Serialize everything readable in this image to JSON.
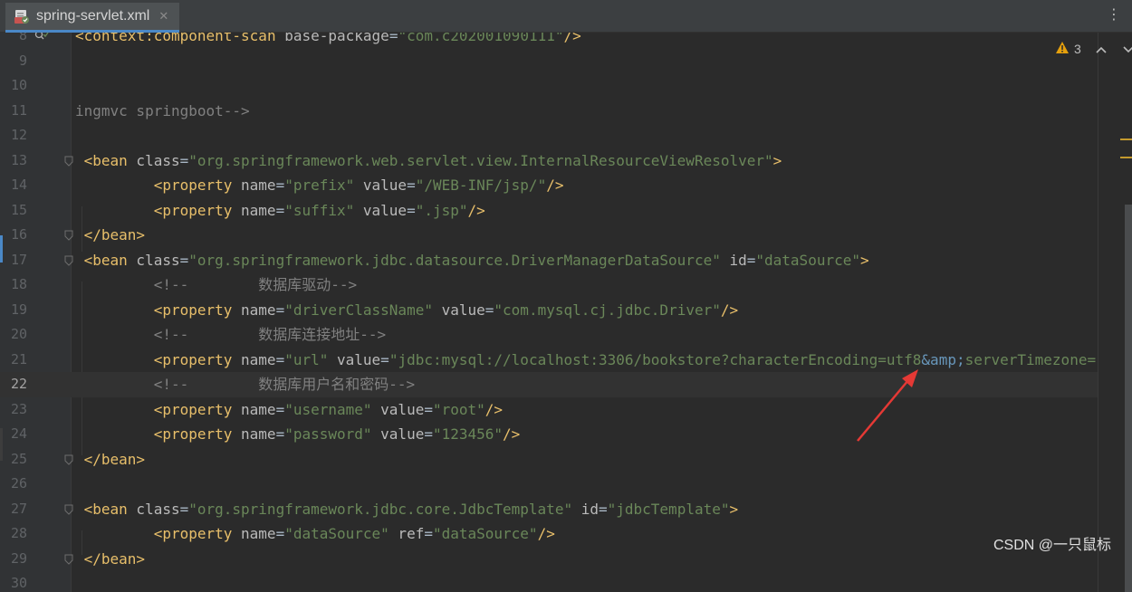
{
  "tab": {
    "title": "spring-servlet.xml",
    "close": "✕"
  },
  "tab_menu": "⋮",
  "inspections": {
    "warning_count": "3",
    "up": "︿",
    "down": "﹀"
  },
  "colors": {
    "accent": "#4a88c7",
    "tag": "#e8bf6a",
    "attribute": "#bababa",
    "value": "#6a8759",
    "comment": "#808080",
    "entity": "#6897bb",
    "warning": "#c49a2e"
  },
  "current_line": 22,
  "lines": [
    {
      "num": "8",
      "tokens": [
        {
          "t": "<",
          "c": "tag"
        },
        {
          "t": "context",
          "c": "tag"
        },
        {
          "t": ":component-scan",
          "c": "tag"
        },
        {
          "t": " base-package",
          "c": "attr"
        },
        {
          "t": "=",
          "c": "plain"
        },
        {
          "t": "\"com.c202001090111\"",
          "c": "val"
        },
        {
          "t": "/>",
          "c": "tag"
        }
      ]
    },
    {
      "num": "9",
      "tokens": []
    },
    {
      "num": "10",
      "tokens": []
    },
    {
      "num": "11",
      "tokens": [
        {
          "t": "ingmvc springboot-->",
          "c": "cmt"
        }
      ]
    },
    {
      "num": "12",
      "tokens": []
    },
    {
      "num": "13",
      "fold": true,
      "tokens": [
        {
          "t": " <bean",
          "c": "tag"
        },
        {
          "t": " class",
          "c": "attr"
        },
        {
          "t": "=",
          "c": "plain"
        },
        {
          "t": "\"org.springframework.web.servlet.view.InternalResourceViewResolver\"",
          "c": "val"
        },
        {
          "t": ">",
          "c": "tag"
        }
      ]
    },
    {
      "num": "14",
      "tokens": [
        {
          "t": "         <property",
          "c": "tag"
        },
        {
          "t": " name",
          "c": "attr"
        },
        {
          "t": "=",
          "c": "plain"
        },
        {
          "t": "\"prefix\"",
          "c": "val"
        },
        {
          "t": " value",
          "c": "attr"
        },
        {
          "t": "=",
          "c": "plain"
        },
        {
          "t": "\"/WEB-INF/jsp/\"",
          "c": "val"
        },
        {
          "t": "/>",
          "c": "tag"
        }
      ]
    },
    {
      "num": "15",
      "tokens": [
        {
          "t": "         <property",
          "c": "tag"
        },
        {
          "t": " name",
          "c": "attr"
        },
        {
          "t": "=",
          "c": "plain"
        },
        {
          "t": "\"suffix\"",
          "c": "val"
        },
        {
          "t": " value",
          "c": "attr"
        },
        {
          "t": "=",
          "c": "plain"
        },
        {
          "t": "\".jsp\"",
          "c": "val"
        },
        {
          "t": "/>",
          "c": "tag"
        }
      ]
    },
    {
      "num": "16",
      "fold": true,
      "tokens": [
        {
          "t": " </bean>",
          "c": "tag"
        }
      ]
    },
    {
      "num": "17",
      "fold": true,
      "tokens": [
        {
          "t": " <bean",
          "c": "tag"
        },
        {
          "t": " class",
          "c": "attr"
        },
        {
          "t": "=",
          "c": "plain"
        },
        {
          "t": "\"org.springframework.jdbc.datasource.DriverManagerDataSource\"",
          "c": "val"
        },
        {
          "t": " id",
          "c": "attr"
        },
        {
          "t": "=",
          "c": "plain"
        },
        {
          "t": "\"dataSource\"",
          "c": "val"
        },
        {
          "t": ">",
          "c": "tag"
        }
      ]
    },
    {
      "num": "18",
      "tokens": [
        {
          "t": "         <!--        数据库驱动-->",
          "c": "cmt"
        }
      ]
    },
    {
      "num": "19",
      "tokens": [
        {
          "t": "         <property",
          "c": "tag"
        },
        {
          "t": " name",
          "c": "attr"
        },
        {
          "t": "=",
          "c": "plain"
        },
        {
          "t": "\"driverClassName\"",
          "c": "val"
        },
        {
          "t": " value",
          "c": "attr"
        },
        {
          "t": "=",
          "c": "plain"
        },
        {
          "t": "\"com.mysql.cj.jdbc.Driver\"",
          "c": "val"
        },
        {
          "t": "/>",
          "c": "tag"
        }
      ]
    },
    {
      "num": "20",
      "tokens": [
        {
          "t": "         <!--        数据库连接地址-->",
          "c": "cmt"
        }
      ]
    },
    {
      "num": "21",
      "tokens": [
        {
          "t": "         <property",
          "c": "tag"
        },
        {
          "t": " name",
          "c": "attr"
        },
        {
          "t": "=",
          "c": "plain"
        },
        {
          "t": "\"url\"",
          "c": "val"
        },
        {
          "t": " value",
          "c": "attr"
        },
        {
          "t": "=",
          "c": "plain"
        },
        {
          "t": "\"jdbc:mysql://localhost:3306/bookstore?characterEncoding=utf8",
          "c": "val"
        },
        {
          "t": "&amp;",
          "c": "ent"
        },
        {
          "t": "serverTimezone=",
          "c": "val"
        }
      ]
    },
    {
      "num": "22",
      "tokens": [
        {
          "t": "         <!--        数据库用户名和密码-->",
          "c": "cmt"
        }
      ]
    },
    {
      "num": "23",
      "tokens": [
        {
          "t": "         <property",
          "c": "tag"
        },
        {
          "t": " name",
          "c": "attr"
        },
        {
          "t": "=",
          "c": "plain"
        },
        {
          "t": "\"username\"",
          "c": "val"
        },
        {
          "t": " value",
          "c": "attr"
        },
        {
          "t": "=",
          "c": "plain"
        },
        {
          "t": "\"root\"",
          "c": "val"
        },
        {
          "t": "/>",
          "c": "tag"
        }
      ]
    },
    {
      "num": "24",
      "tokens": [
        {
          "t": "         <property",
          "c": "tag"
        },
        {
          "t": " name",
          "c": "attr"
        },
        {
          "t": "=",
          "c": "plain"
        },
        {
          "t": "\"password\"",
          "c": "val"
        },
        {
          "t": " value",
          "c": "attr"
        },
        {
          "t": "=",
          "c": "plain"
        },
        {
          "t": "\"123456\"",
          "c": "val"
        },
        {
          "t": "/>",
          "c": "tag"
        }
      ]
    },
    {
      "num": "25",
      "fold": true,
      "tokens": [
        {
          "t": " </bean>",
          "c": "tag"
        }
      ]
    },
    {
      "num": "26",
      "tokens": []
    },
    {
      "num": "27",
      "fold": true,
      "tokens": [
        {
          "t": " <bean",
          "c": "tag"
        },
        {
          "t": " class",
          "c": "attr"
        },
        {
          "t": "=",
          "c": "plain"
        },
        {
          "t": "\"org.springframework.jdbc.core.JdbcTemplate\"",
          "c": "val"
        },
        {
          "t": " id",
          "c": "attr"
        },
        {
          "t": "=",
          "c": "plain"
        },
        {
          "t": "\"jdbcTemplate\"",
          "c": "val"
        },
        {
          "t": ">",
          "c": "tag"
        }
      ]
    },
    {
      "num": "28",
      "tokens": [
        {
          "t": "         <property",
          "c": "tag"
        },
        {
          "t": " name",
          "c": "attr"
        },
        {
          "t": "=",
          "c": "plain"
        },
        {
          "t": "\"dataSource\"",
          "c": "val"
        },
        {
          "t": " ref",
          "c": "attr"
        },
        {
          "t": "=",
          "c": "plain"
        },
        {
          "t": "\"dataSource\"",
          "c": "val"
        },
        {
          "t": "/>",
          "c": "tag"
        }
      ]
    },
    {
      "num": "29",
      "fold": true,
      "tokens": [
        {
          "t": " </bean>",
          "c": "tag"
        }
      ]
    },
    {
      "num": "30",
      "tokens": []
    }
  ],
  "watermark": "CSDN @一只鼠标"
}
